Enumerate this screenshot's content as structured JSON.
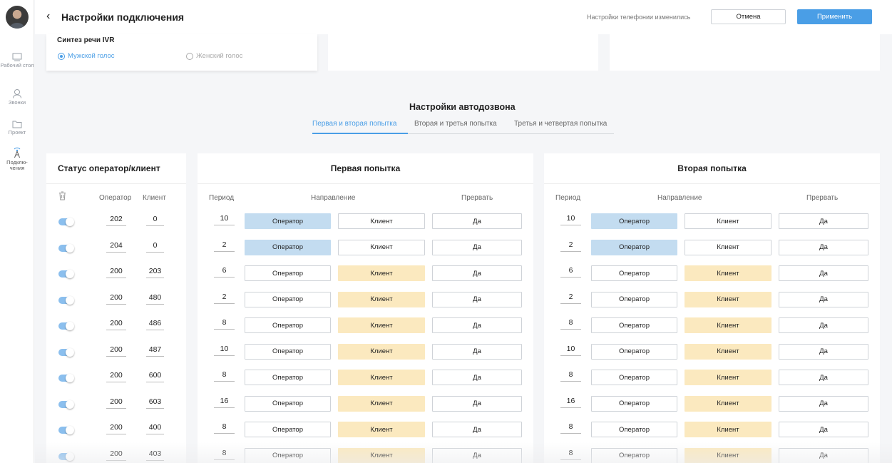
{
  "header": {
    "back_icon": "chevron-left-icon",
    "title": "Настройки подключения",
    "status": "Настройки телефонии изменились",
    "cancel_label": "Отмена",
    "apply_label": "Применить",
    "accent_color": "#4a9ee6"
  },
  "nav": {
    "items": [
      {
        "label": "Рабочий стол",
        "icon": "desktop-icon"
      },
      {
        "label": "Звонки",
        "icon": "person-icon"
      },
      {
        "label": "Проект",
        "icon": "folder-icon"
      },
      {
        "label": "Подклю-чения",
        "icon": "antenna-icon"
      }
    ]
  },
  "ivr": {
    "title": "Синтез речи IVR",
    "options": [
      {
        "label": "Мужской голос",
        "selected": true
      },
      {
        "label": "Женский голос",
        "selected": false
      }
    ]
  },
  "autodial": {
    "title": "Настройки автодозвона",
    "tabs": [
      "Первая и вторая попытка",
      "Вторая и третья попытка",
      "Третья и четвертая попытка"
    ],
    "active_tab": 0
  },
  "status_panel": {
    "title": "Статус оператор/клиент",
    "trash_icon": "trash-icon",
    "col_operator": "Оператор",
    "col_client": "Клиент",
    "rows": [
      {
        "enabled": true,
        "operator": "202",
        "client": "0"
      },
      {
        "enabled": true,
        "operator": "204",
        "client": "0"
      },
      {
        "enabled": true,
        "operator": "200",
        "client": "203"
      },
      {
        "enabled": true,
        "operator": "200",
        "client": "480"
      },
      {
        "enabled": true,
        "operator": "200",
        "client": "486"
      },
      {
        "enabled": true,
        "operator": "200",
        "client": "487"
      },
      {
        "enabled": true,
        "operator": "200",
        "client": "600"
      },
      {
        "enabled": true,
        "operator": "200",
        "client": "603"
      },
      {
        "enabled": true,
        "operator": "200",
        "client": "400"
      },
      {
        "enabled": true,
        "operator": "200",
        "client": "403"
      }
    ]
  },
  "attempt_columns": {
    "period": "Период",
    "direction": "Направление",
    "interrupt": "Прервать",
    "operator_label": "Оператор",
    "client_label": "Клиент",
    "interrupt_value": "Да"
  },
  "attempts": [
    {
      "title": "Первая попытка",
      "rows": [
        {
          "period": "10",
          "direction": "operator"
        },
        {
          "period": "2",
          "direction": "operator"
        },
        {
          "period": "6",
          "direction": "client"
        },
        {
          "period": "2",
          "direction": "client"
        },
        {
          "period": "8",
          "direction": "client"
        },
        {
          "period": "10",
          "direction": "client"
        },
        {
          "period": "8",
          "direction": "client"
        },
        {
          "period": "16",
          "direction": "client"
        },
        {
          "period": "8",
          "direction": "client"
        },
        {
          "period": "8",
          "direction": "client"
        }
      ]
    },
    {
      "title": "Вторая попытка",
      "rows": [
        {
          "period": "10",
          "direction": "operator"
        },
        {
          "period": "2",
          "direction": "operator"
        },
        {
          "period": "6",
          "direction": "client"
        },
        {
          "period": "2",
          "direction": "client"
        },
        {
          "period": "8",
          "direction": "client"
        },
        {
          "period": "10",
          "direction": "client"
        },
        {
          "period": "8",
          "direction": "client"
        },
        {
          "period": "16",
          "direction": "client"
        },
        {
          "period": "8",
          "direction": "client"
        },
        {
          "period": "8",
          "direction": "client"
        }
      ]
    }
  ],
  "colors": {
    "operator_selected": "#c3dcf0",
    "client_selected": "#fbe9bf",
    "toggle_on": "#8bbfee"
  }
}
